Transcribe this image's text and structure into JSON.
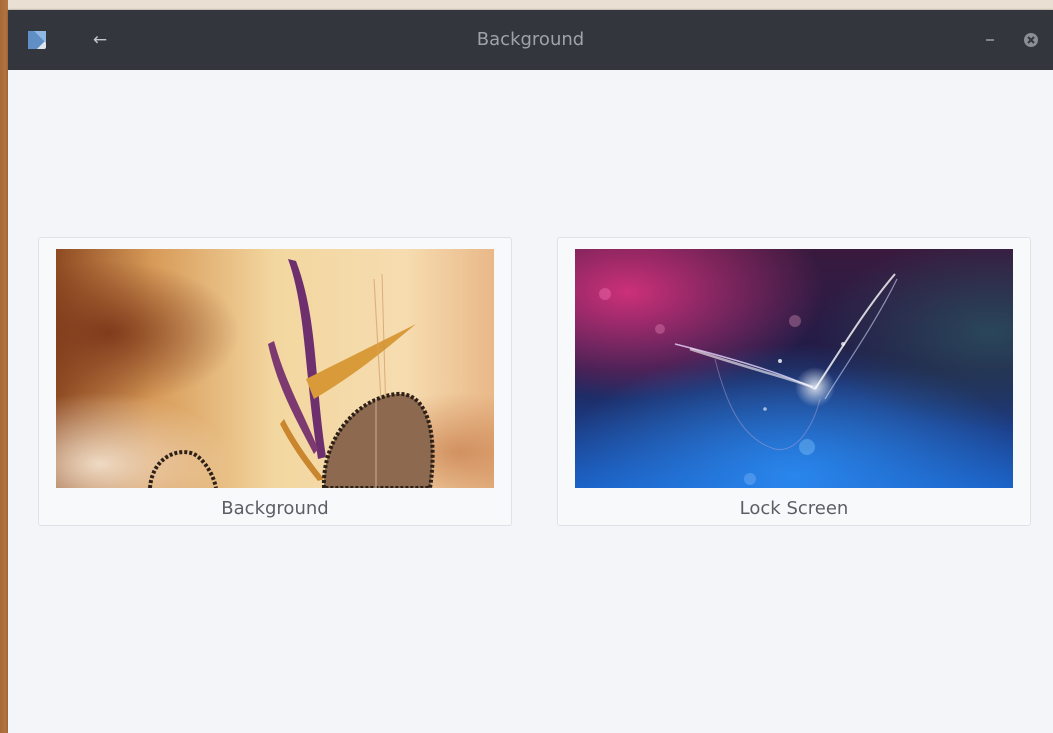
{
  "window": {
    "title": "Background"
  },
  "titlebar": {
    "app_icon": "wallpaper-app-icon",
    "back_icon": "arrow-left-icon",
    "back_glyph": "←",
    "minimize_icon": "minimize-icon",
    "close_icon": "close-icon"
  },
  "cards": [
    {
      "label": "Background",
      "thumbnail": "warm-feather-wallpaper"
    },
    {
      "label": "Lock Screen",
      "thumbnail": "purple-blue-light-streak-wallpaper"
    }
  ],
  "colors": {
    "titlebar": "#33373d",
    "content_bg": "#f3f5f8",
    "card_border": "#dfe2e6",
    "label_text": "#5a5f66"
  }
}
